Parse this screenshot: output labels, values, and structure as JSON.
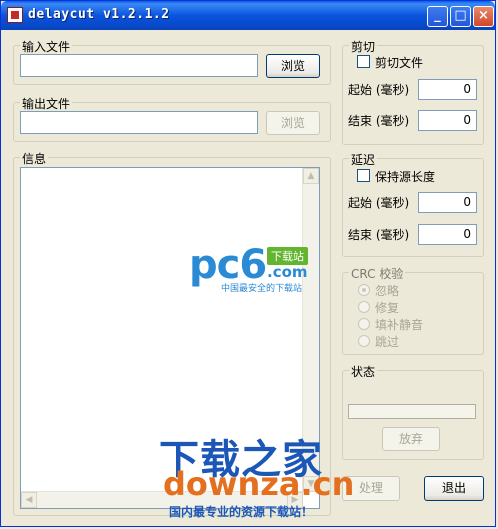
{
  "window": {
    "title": "delaycut v1.2.1.2",
    "minimize_glyph": "_",
    "maximize_glyph": "□",
    "close_glyph": "×"
  },
  "input_group": {
    "label": "输入文件",
    "value": "",
    "browse_label": "浏览"
  },
  "output_group": {
    "label": "输出文件",
    "value": "",
    "browse_label": "浏览"
  },
  "info_group": {
    "label": "信息"
  },
  "cut_group": {
    "label": "剪切",
    "checkbox_label": "剪切文件",
    "checked": false,
    "start_label": "起始 (毫秒)",
    "start_value": "0",
    "end_label": "结束 (毫秒)",
    "end_value": "0"
  },
  "delay_group": {
    "label": "延迟",
    "checkbox_label": "保持源长度",
    "checked": false,
    "start_label": "起始 (毫秒)",
    "start_value": "0",
    "end_label": "结束 (毫秒)",
    "end_value": "0"
  },
  "crc_group": {
    "label": "CRC 校验",
    "options": [
      "忽略",
      "修复",
      "填补静音",
      "跳过"
    ],
    "selected": "忽略"
  },
  "status_group": {
    "label": "状态",
    "progress": 0,
    "abort_label": "放弃"
  },
  "actions": {
    "process_label": "处理",
    "exit_label": "退出"
  },
  "watermarks": {
    "pc6_main": "pc6",
    "pc6_tag": "下载站",
    "pc6_com": ".com",
    "pc6_sub": "中国最安全的下载站",
    "downza_cn": "下载之家",
    "downza_en": "downza.cn",
    "downza_sub": "国内最专业的资源下载站！"
  },
  "icons": {
    "app_icon": "app-icon",
    "scroll_up": "▲",
    "scroll_down": "▼",
    "scroll_left": "◀",
    "scroll_right": "▶"
  }
}
